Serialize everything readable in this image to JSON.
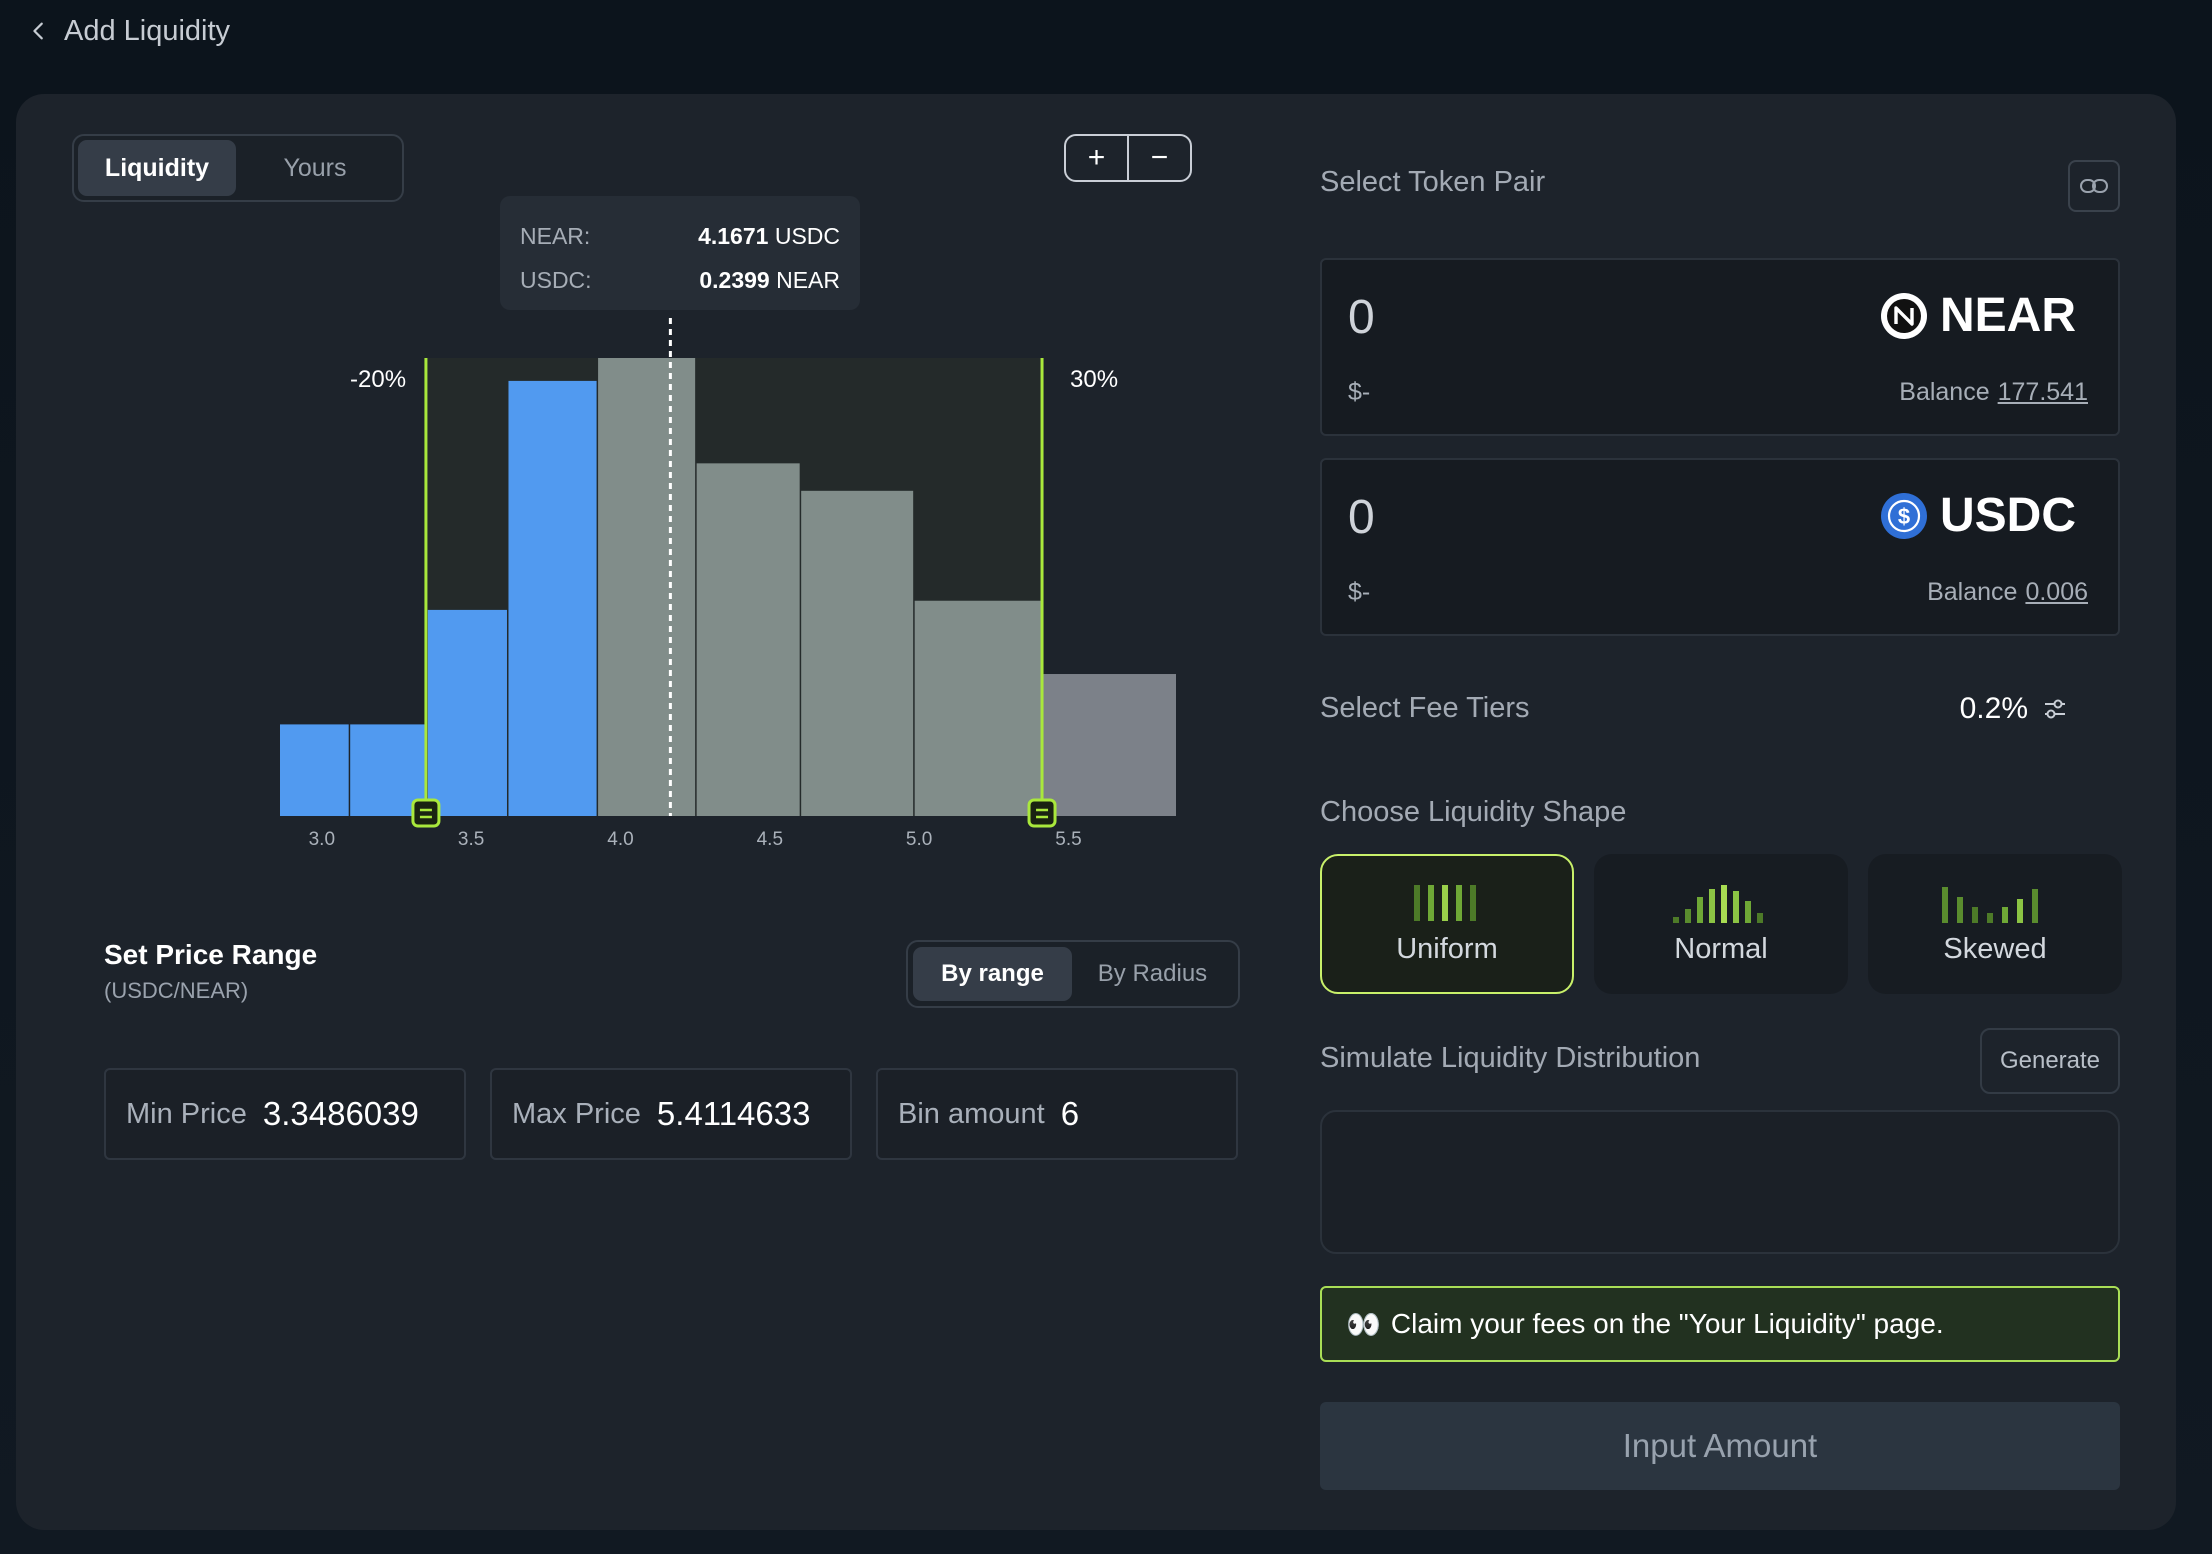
{
  "header": {
    "back_label": "Add Liquidity"
  },
  "chart_tabs": {
    "items": [
      "Liquidity",
      "Yours"
    ],
    "active": "Liquidity"
  },
  "zoom": {
    "plus": "+",
    "minus": "−"
  },
  "tooltip": {
    "near_label": "NEAR:",
    "near_value": "4.1671",
    "near_unit": "USDC",
    "usdc_label": "USDC:",
    "usdc_value": "0.2399",
    "usdc_unit": "NEAR"
  },
  "chart_data": {
    "type": "bar",
    "x_ticks": [
      "3.0",
      "3.5",
      "4.0",
      "4.5",
      "5.0",
      "5.5"
    ],
    "xlim": [
      2.86,
      5.86
    ],
    "ylim": [
      0,
      100
    ],
    "current_price": 4.1671,
    "range_min": 3.3486039,
    "range_max": 5.4114633,
    "range_min_label": "-20%",
    "range_max_label": "30%",
    "bins": [
      {
        "x0": 2.86,
        "x1": 3.09,
        "value": 20,
        "color": "blue"
      },
      {
        "x0": 3.095,
        "x1": 3.35,
        "value": 20,
        "color": "blue"
      },
      {
        "x0": 3.355,
        "x1": 3.62,
        "value": 45,
        "color": "blue"
      },
      {
        "x0": 3.625,
        "x1": 3.92,
        "value": 95,
        "color": "blue"
      },
      {
        "x0": 3.925,
        "x1": 4.25,
        "value": 100,
        "color": "gray"
      },
      {
        "x0": 4.255,
        "x1": 4.6,
        "value": 77,
        "color": "gray"
      },
      {
        "x0": 4.605,
        "x1": 4.98,
        "value": 71,
        "color": "gray"
      },
      {
        "x0": 4.985,
        "x1": 5.41,
        "value": 47,
        "color": "gray"
      },
      {
        "x0": 5.415,
        "x1": 5.86,
        "value": 31,
        "color": "lightgray"
      }
    ],
    "colors": {
      "blue": "#519af0",
      "gray": "#818d8a",
      "lightgray": "#7c8189",
      "range": "#a9e83c"
    }
  },
  "price_range": {
    "title": "Set Price Range",
    "subtitle": "(USDC/NEAR)",
    "modes": [
      "By range",
      "By Radius"
    ],
    "active_mode": "By range",
    "min_label": "Min Price",
    "min_value": "3.3486039",
    "max_label": "Max Price",
    "max_value": "5.4114633",
    "bin_label": "Bin amount",
    "bin_value": "6"
  },
  "token_pair": {
    "label": "Select Token Pair",
    "tokens": [
      {
        "amount": "0",
        "usd": "$-",
        "symbol": "NEAR",
        "balance_label": "Balance",
        "balance": "177.541"
      },
      {
        "amount": "0",
        "usd": "$-",
        "symbol": "USDC",
        "balance_label": "Balance",
        "balance": "0.006"
      }
    ]
  },
  "fee": {
    "label": "Select Fee Tiers",
    "value": "0.2%"
  },
  "shape": {
    "label": "Choose Liquidity Shape",
    "options": [
      "Uniform",
      "Normal",
      "Skewed"
    ],
    "active": "Uniform"
  },
  "simulate": {
    "label": "Simulate Liquidity Distribution",
    "button": "Generate"
  },
  "notice": {
    "emoji": "👀",
    "text": "Claim your fees on the \"Your Liquidity\" page."
  },
  "submit": {
    "label": "Input Amount"
  }
}
